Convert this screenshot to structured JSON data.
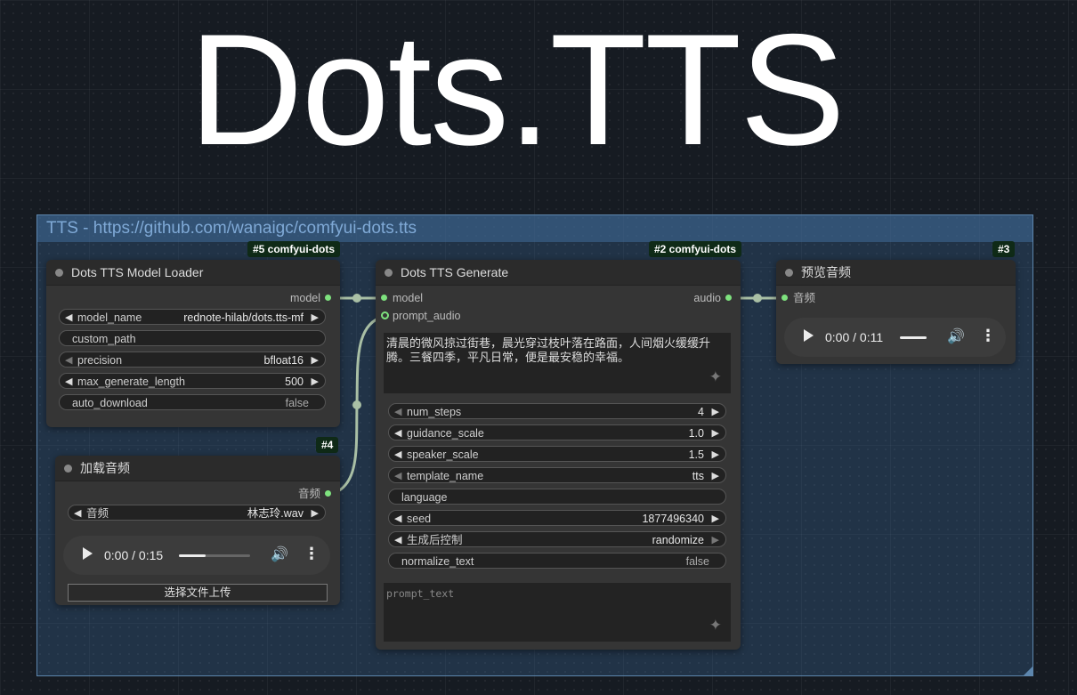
{
  "title": "Dots.TTS",
  "group": {
    "title": "TTS - https://github.com/wanaigc/comfyui-dots.tts"
  },
  "loader": {
    "badge": "#5 comfyui-dots",
    "title": "Dots TTS Model Loader",
    "output": "model",
    "widgets": [
      {
        "label": "model_name",
        "value": "rednote-hilab/dots.tts-mf"
      },
      {
        "label": "custom_path",
        "value": ""
      },
      {
        "label": "precision",
        "value": "bfloat16"
      },
      {
        "label": "max_generate_length",
        "value": "500"
      },
      {
        "label": "auto_download",
        "value": "false"
      }
    ]
  },
  "load_audio": {
    "badge": "#4",
    "title": "加载音频",
    "output": "音频",
    "widget": {
      "label": "音频",
      "value": "林志玲.wav"
    },
    "player": {
      "time": "0:00 / 0:15",
      "progress": 0.38
    },
    "upload_label": "选择文件上传"
  },
  "generate": {
    "badge": "#2 comfyui-dots",
    "title": "Dots TTS Generate",
    "inputs": [
      "model",
      "prompt_audio"
    ],
    "output": "audio",
    "text": "清晨的微风掠过街巷，晨光穿过枝叶落在路面，人间烟火缓缓升腾。三餐四季，平凡日常，便是最安稳的幸福。",
    "widgets": [
      {
        "label": "num_steps",
        "value": "4"
      },
      {
        "label": "guidance_scale",
        "value": "1.0"
      },
      {
        "label": "speaker_scale",
        "value": "1.5"
      },
      {
        "label": "template_name",
        "value": "tts"
      },
      {
        "label": "language",
        "value": ""
      },
      {
        "label": "seed",
        "value": "1877496340"
      },
      {
        "label": "生成后控制",
        "value": "randomize"
      },
      {
        "label": "normalize_text",
        "value": "false"
      }
    ],
    "prompt_text_placeholder": "prompt_text"
  },
  "preview": {
    "badge": "#3",
    "title": "预览音频",
    "input": "音频",
    "player": {
      "time": "0:00 / 0:11",
      "progress": 0
    }
  },
  "colors": {
    "port": "#7ee27e",
    "link": "#a9bfa5",
    "badge_bg": "#0f2a17"
  }
}
